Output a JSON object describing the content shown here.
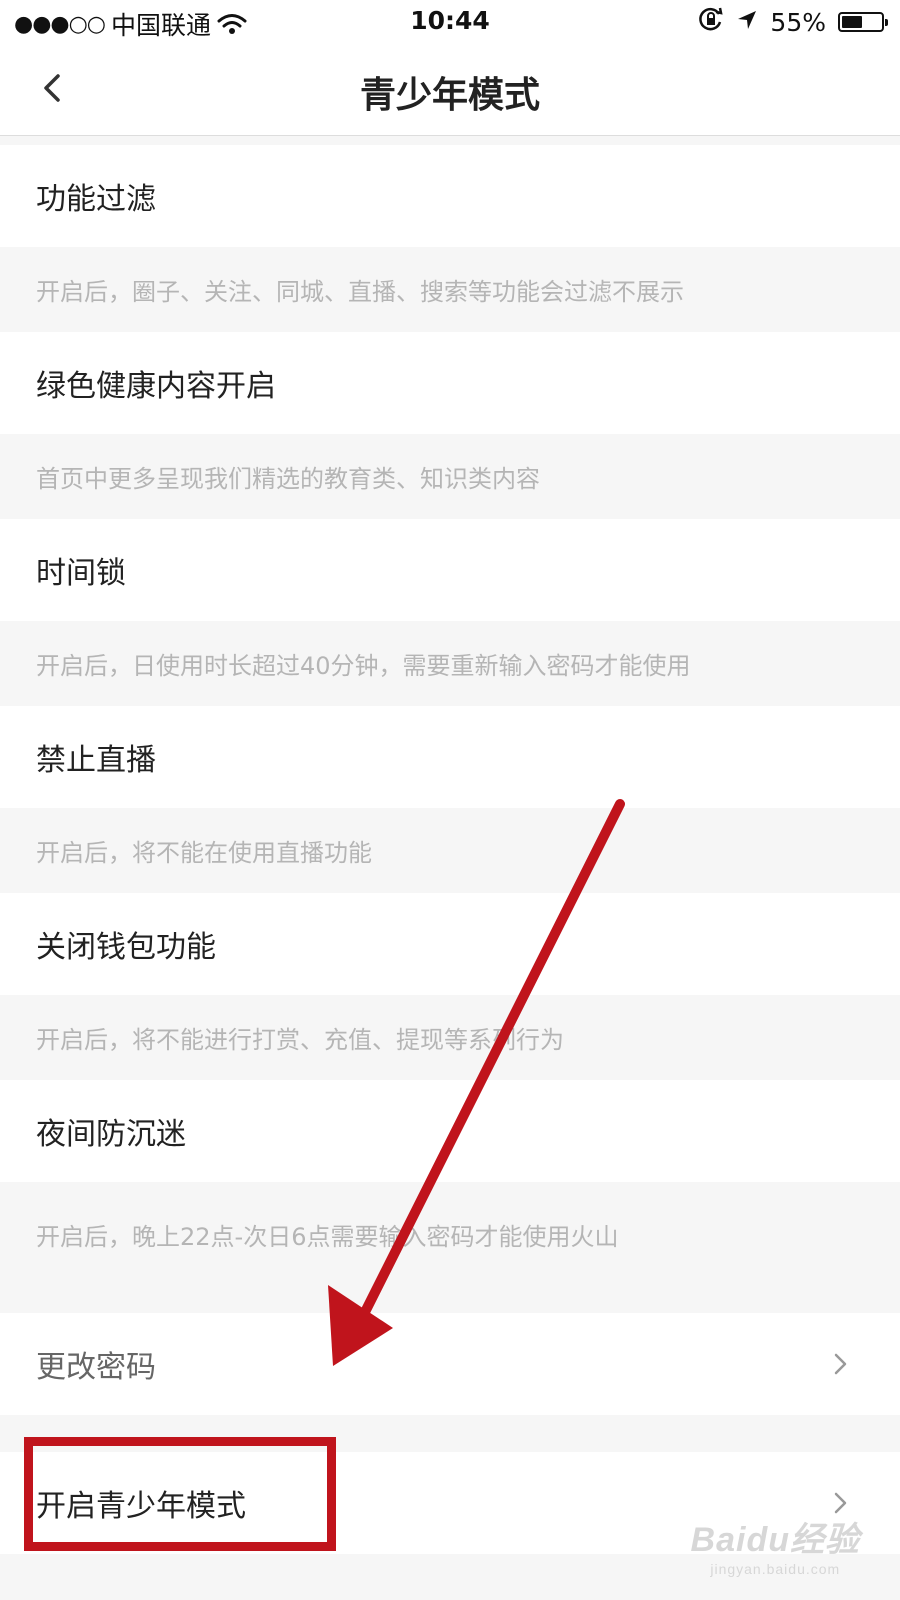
{
  "status_bar": {
    "signal": "●●●○○",
    "carrier": "中国联通",
    "time": "10:44",
    "battery": "55%",
    "battery_level": 0.55
  },
  "header": {
    "title": "青少年模式"
  },
  "settings": [
    {
      "title": "功能过滤",
      "description": "开启后，圈子、关注、同城、直播、搜索等功能会过滤不展示"
    },
    {
      "title": "绿色健康内容开启",
      "description": "首页中更多呈现我们精选的教育类、知识类内容"
    },
    {
      "title": "时间锁",
      "description": "开启后，日使用时长超过40分钟，需要重新输入密码才能使用"
    },
    {
      "title": "禁止直播",
      "description": "开启后，将不能在使用直播功能"
    },
    {
      "title": "关闭钱包功能",
      "description": "开启后，将不能进行打赏、充值、提现等系列行为"
    },
    {
      "title": "夜间防沉迷",
      "description": "开启后，晚上22点-次日6点需要输入密码才能使用火山"
    }
  ],
  "actions": {
    "change_password": "更改密码",
    "enable_youth_mode": "开启青少年模式"
  },
  "watermark": {
    "logo": "Baidu经验",
    "url": "jingyan.baidu.com"
  },
  "colors": {
    "annotation": "#c0141c"
  }
}
